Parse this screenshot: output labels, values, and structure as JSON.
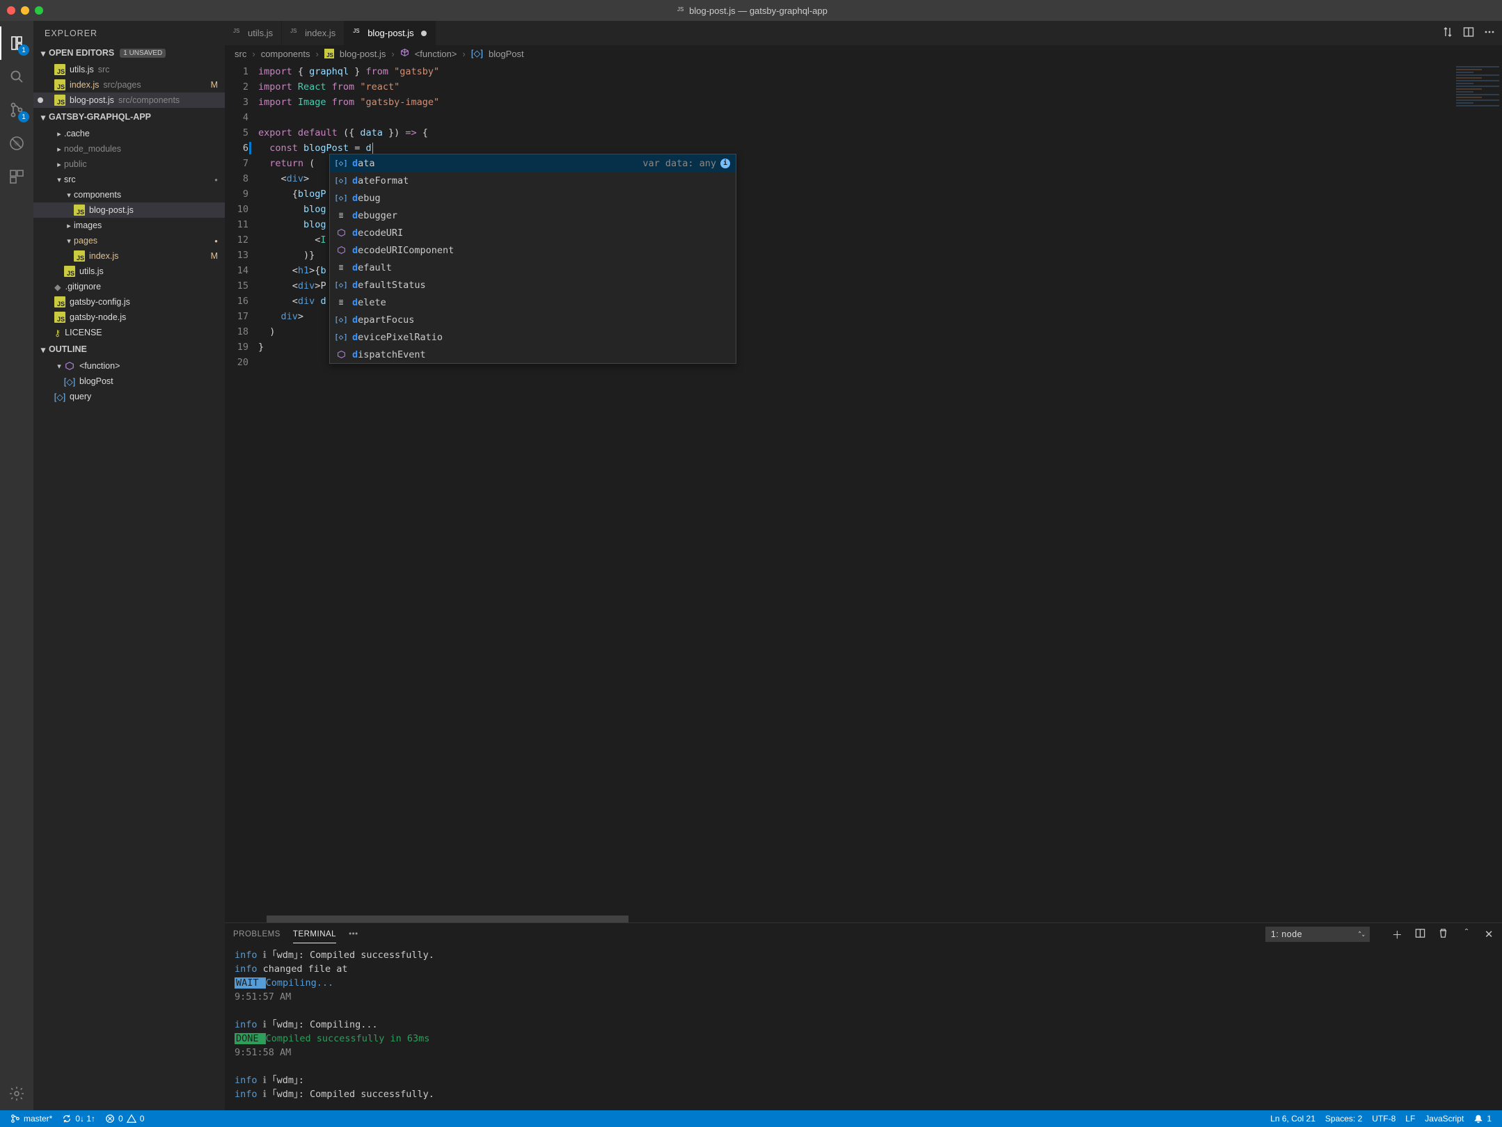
{
  "window": {
    "filename_icon": "js",
    "title": "blog-post.js — gatsby-graphql-app"
  },
  "activitybar": {
    "files_badge": "1",
    "scm_badge": "1"
  },
  "explorer": {
    "title": "EXPLORER",
    "open_editors": {
      "label": "OPEN EDITORS",
      "unsaved_tag": "1 UNSAVED",
      "items": [
        {
          "name": "utils.js",
          "path": "src",
          "dirty": false,
          "status": ""
        },
        {
          "name": "index.js",
          "path": "src/pages",
          "dirty": false,
          "status": "M"
        },
        {
          "name": "blog-post.js",
          "path": "src/components",
          "dirty": true,
          "status": ""
        }
      ]
    },
    "project": {
      "label": "GATSBY-GRAPHQL-APP"
    },
    "tree": [
      {
        "kind": "folder",
        "name": ".cache",
        "depth": 1,
        "open": false
      },
      {
        "kind": "folder",
        "name": "node_modules",
        "depth": 1,
        "open": false,
        "dim": true
      },
      {
        "kind": "folder",
        "name": "public",
        "depth": 1,
        "open": false,
        "dim": true
      },
      {
        "kind": "folder",
        "name": "src",
        "depth": 1,
        "open": true,
        "git": "dot"
      },
      {
        "kind": "folder",
        "name": "components",
        "depth": 2,
        "open": true
      },
      {
        "kind": "file",
        "name": "blog-post.js",
        "depth": 3,
        "icon": "js",
        "selected": true
      },
      {
        "kind": "folder",
        "name": "images",
        "depth": 2,
        "open": false
      },
      {
        "kind": "folder",
        "name": "pages",
        "depth": 2,
        "open": true,
        "git": "dot",
        "gitcolor": true
      },
      {
        "kind": "file",
        "name": "index.js",
        "depth": 3,
        "icon": "js",
        "status": "M",
        "gitcolor": true
      },
      {
        "kind": "file",
        "name": "utils.js",
        "depth": 2,
        "icon": "js"
      },
      {
        "kind": "file",
        "name": ".gitignore",
        "depth": 1,
        "icon": "git"
      },
      {
        "kind": "file",
        "name": "gatsby-config.js",
        "depth": 1,
        "icon": "js"
      },
      {
        "kind": "file",
        "name": "gatsby-node.js",
        "depth": 1,
        "icon": "js"
      },
      {
        "kind": "file",
        "name": "LICENSE",
        "depth": 1,
        "icon": "cert"
      }
    ],
    "outline": {
      "label": "OUTLINE",
      "items": [
        {
          "name": "<function>",
          "icon": "cube",
          "depth": 1,
          "open": true
        },
        {
          "name": "blogPost",
          "icon": "var",
          "depth": 2
        },
        {
          "name": "query",
          "icon": "var",
          "depth": 1
        }
      ]
    }
  },
  "tabs": [
    {
      "label": "utils.js",
      "icon": "js",
      "active": false,
      "dirty": false
    },
    {
      "label": "index.js",
      "icon": "js",
      "active": false,
      "dirty": false
    },
    {
      "label": "blog-post.js",
      "icon": "js",
      "active": true,
      "dirty": true
    }
  ],
  "breadcrumbs": [
    "src",
    "components",
    "blog-post.js",
    "<function>",
    "blogPost"
  ],
  "editor": {
    "line_numbers": [
      "1",
      "2",
      "3",
      "4",
      "5",
      "6",
      "7",
      "8",
      "9",
      "10",
      "11",
      "12",
      "13",
      "14",
      "15",
      "16",
      "17",
      "18",
      "19",
      "20"
    ],
    "current_line": 6,
    "active_line_col": "Ln 6, Col 21",
    "code": {
      "l1": {
        "a": "import",
        "b": "{ ",
        "c": "graphql",
        "d": " }",
        "e": " from ",
        "f": "\"gatsby\""
      },
      "l2": {
        "a": "import ",
        "b": "React",
        "c": " from ",
        "d": "\"react\""
      },
      "l3": {
        "a": "import ",
        "b": "Image",
        "c": " from ",
        "d": "\"gatsby-image\""
      },
      "l5": {
        "a": "export",
        "b": " default",
        "c": " ({ ",
        "d": "data",
        "e": " }) ",
        "f": "=>",
        "g": " {"
      },
      "l6": {
        "a": "  const ",
        "b": "blogPost",
        "c": " = ",
        "d": "d"
      },
      "l7": {
        "a": "  ",
        "b": "return",
        "c": " ("
      },
      "l8": {
        "a": "    <",
        "b": "div",
        "c": ">"
      },
      "l9": {
        "a": "      {",
        "b": "blogP"
      },
      "l10": {
        "a": "        ",
        "b": "blog"
      },
      "l11": {
        "a": "        ",
        "b": "blog"
      },
      "l12": {
        "a": "          <",
        "b": "I"
      },
      "l13": {
        "a": "        )}",
        "b": ""
      },
      "l14": {
        "a": "      <",
        "b": "h1",
        "c": ">{",
        "d": "b"
      },
      "l15": {
        "a": "      <",
        "b": "div",
        "c": ">",
        "d": "P"
      },
      "l16": {
        "a": "      <",
        "b": "div",
        "c": " ",
        "d": "d"
      },
      "l17": {
        "a": "    </",
        "b": "div",
        "c": ">"
      },
      "l18": {
        "a": "  )"
      },
      "l19": {
        "a": "}"
      }
    }
  },
  "suggest": {
    "hint": "var data: any",
    "items": [
      {
        "icon": "var",
        "label": "data",
        "match": "d",
        "rest": "ata",
        "selected": true
      },
      {
        "icon": "var",
        "label": "dateFormat",
        "match": "d",
        "rest": "ateFormat"
      },
      {
        "icon": "var",
        "label": "debug",
        "match": "d",
        "rest": "ebug"
      },
      {
        "icon": "kw",
        "label": "debugger",
        "match": "d",
        "rest": "ebugger"
      },
      {
        "icon": "mth",
        "label": "decodeURI",
        "match": "d",
        "rest": "ecodeURI"
      },
      {
        "icon": "mth",
        "label": "decodeURIComponent",
        "match": "d",
        "rest": "ecodeURIComponent"
      },
      {
        "icon": "kw",
        "label": "default",
        "match": "d",
        "rest": "efault"
      },
      {
        "icon": "var",
        "label": "defaultStatus",
        "match": "d",
        "rest": "efaultStatus"
      },
      {
        "icon": "kw",
        "label": "delete",
        "match": "d",
        "rest": "elete"
      },
      {
        "icon": "var",
        "label": "departFocus",
        "match": "d",
        "rest": "epartFocus"
      },
      {
        "icon": "var",
        "label": "devicePixelRatio",
        "match": "d",
        "rest": "evicePixelRatio"
      },
      {
        "icon": "mth",
        "label": "dispatchEvent",
        "match": "d",
        "rest": "ispatchEvent"
      }
    ]
  },
  "panel": {
    "tabs": {
      "problems": "PROBLEMS",
      "terminal": "TERMINAL"
    },
    "selector": "1: node",
    "lines": [
      {
        "t": "info",
        "a": "info ",
        "b": "ℹ",
        "c": " ｢wdm｣: Compiled successfully."
      },
      {
        "t": "info",
        "a": "info ",
        "c": "changed file at"
      },
      {
        "t": "wait",
        "a": " WAIT ",
        "c": " Compiling..."
      },
      {
        "t": "dim",
        "c": "9:51:57 AM"
      },
      {
        "t": "blank"
      },
      {
        "t": "info",
        "a": "info ",
        "b": "ℹ",
        "c": " ｢wdm｣: Compiling..."
      },
      {
        "t": "done",
        "a": " DONE ",
        "c": " Compiled successfully in 63ms"
      },
      {
        "t": "dim",
        "c": "9:51:58 AM"
      },
      {
        "t": "blank"
      },
      {
        "t": "info",
        "a": "info ",
        "b": "ℹ",
        "c": " ｢wdm｣:"
      },
      {
        "t": "info",
        "a": "info ",
        "b": "ℹ",
        "c": " ｢wdm｣: Compiled successfully."
      }
    ]
  },
  "statusbar": {
    "branch": "master*",
    "sync": "0↓ 1↑",
    "errors": "0",
    "warnings": "0",
    "lncol": "Ln 6, Col 21",
    "spaces": "Spaces: 2",
    "encoding": "UTF-8",
    "eol": "LF",
    "lang": "JavaScript",
    "bell": "1"
  }
}
